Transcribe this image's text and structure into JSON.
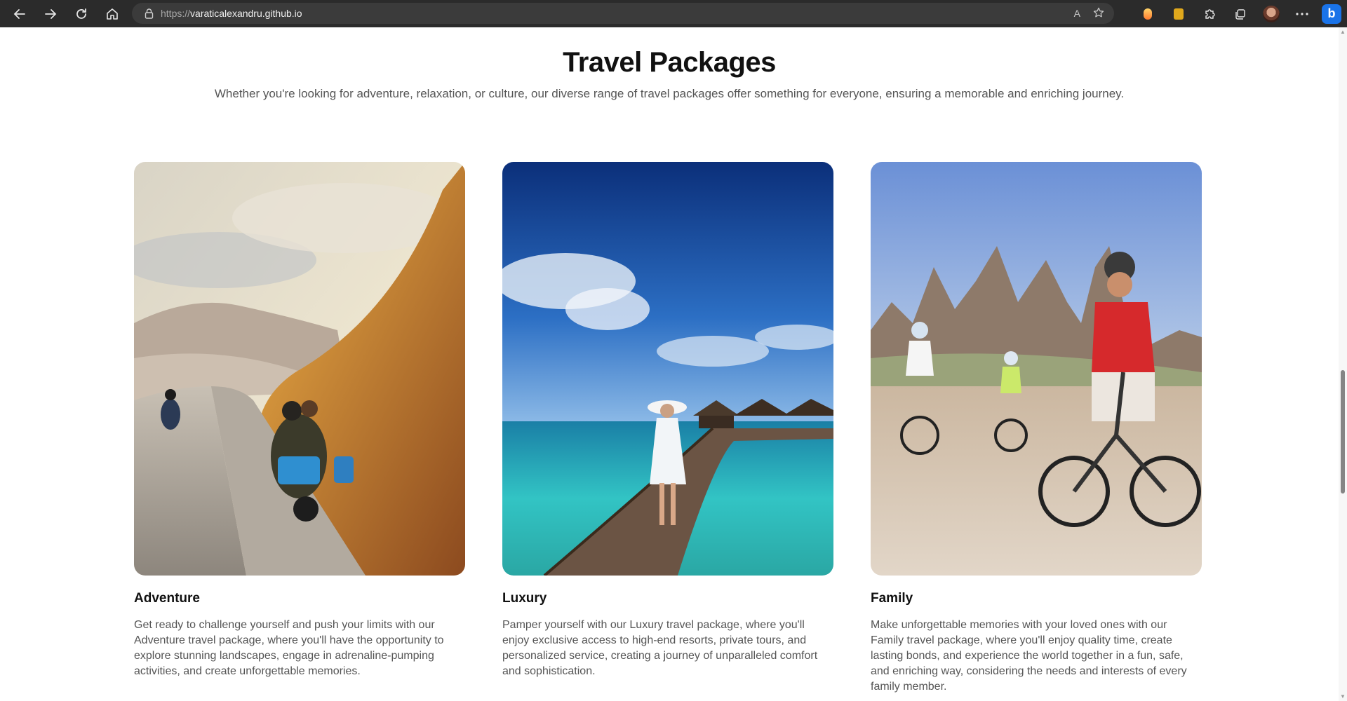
{
  "browser": {
    "url_prefix": "https://",
    "url_host": "varaticalexandru.github.io",
    "read_aloud_label": "A",
    "bing_label": "b"
  },
  "section": {
    "title": "Travel Packages",
    "subtitle": "Whether you're looking for adventure, relaxation, or culture, our diverse range of travel packages offer something for everyone, ensuring a memorable and enriching journey."
  },
  "packages": [
    {
      "title": "Adventure",
      "description": "Get ready to challenge yourself and push your limits with our Adventure travel package, where you'll have the opportunity to explore stunning landscapes, engage in adrenaline-pumping activities, and create unforgettable memories."
    },
    {
      "title": "Luxury",
      "description": "Pamper yourself with our Luxury travel package, where you'll enjoy exclusive access to high-end resorts, private tours, and personalized service, creating a journey of unparalleled comfort and sophistication."
    },
    {
      "title": "Family",
      "description": "Make unforgettable memories with your loved ones with our Family travel package, where you'll enjoy quality time, create lasting bonds, and experience the world together in a fun, safe, and enriching way, considering the needs and interests of every family member."
    }
  ]
}
